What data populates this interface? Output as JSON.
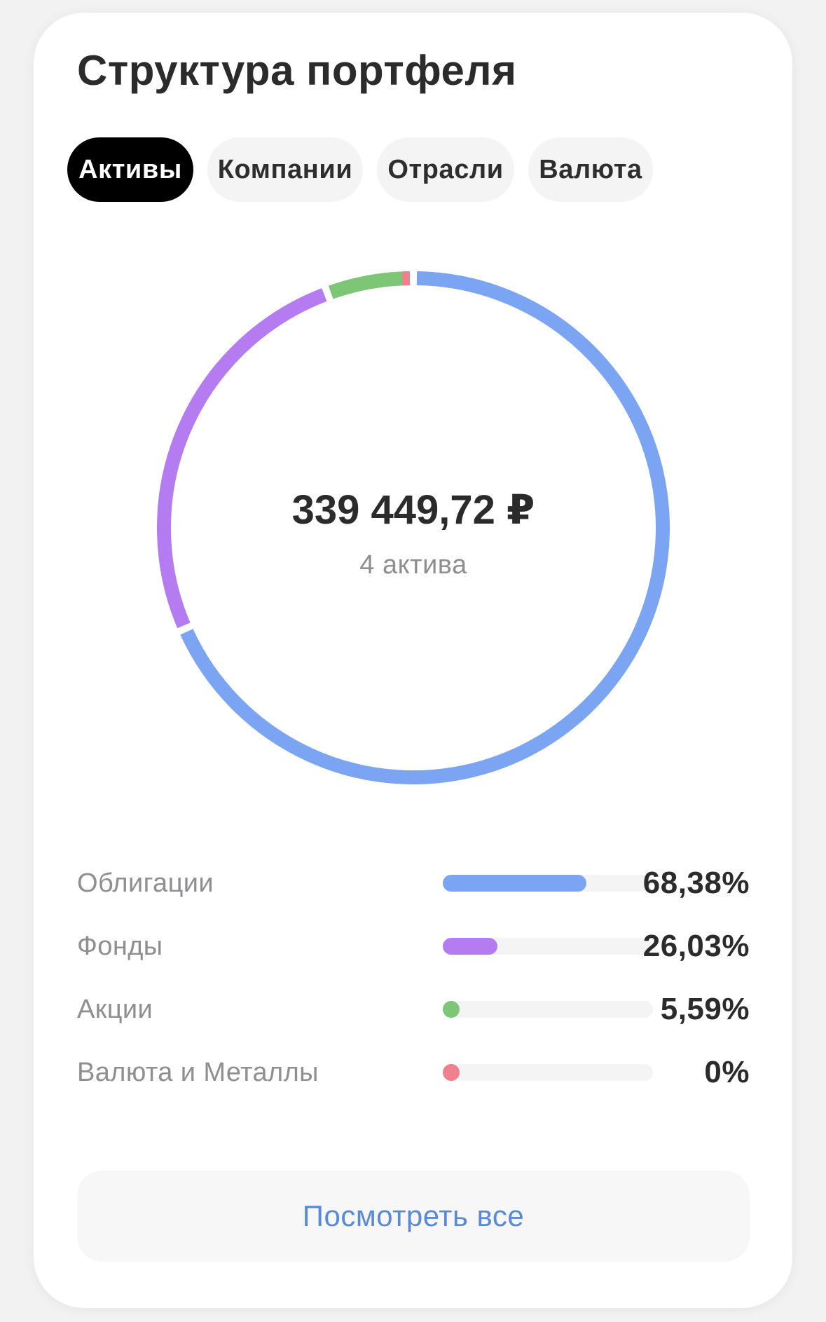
{
  "card": {
    "title": "Структура портфеля"
  },
  "tabs": [
    {
      "label": "Активы",
      "active": true
    },
    {
      "label": "Компании",
      "active": false
    },
    {
      "label": "Отрасли",
      "active": false
    },
    {
      "label": "Валюта",
      "active": false
    }
  ],
  "summary": {
    "total": "339 449,72 ₽",
    "count_label": "4 актива"
  },
  "chart_data": {
    "type": "pie",
    "categories": [
      "Облигации",
      "Фонды",
      "Акции",
      "Валюта и Металлы"
    ],
    "values": [
      68.38,
      26.03,
      5.59,
      0
    ],
    "value_labels": [
      "68,38%",
      "26,03%",
      "5,59%",
      "0%"
    ],
    "colors": [
      "#7ba4f2",
      "#b47cf0",
      "#7cc676",
      "#ee8090"
    ]
  },
  "footer": {
    "view_all_label": "Посмотреть все"
  }
}
